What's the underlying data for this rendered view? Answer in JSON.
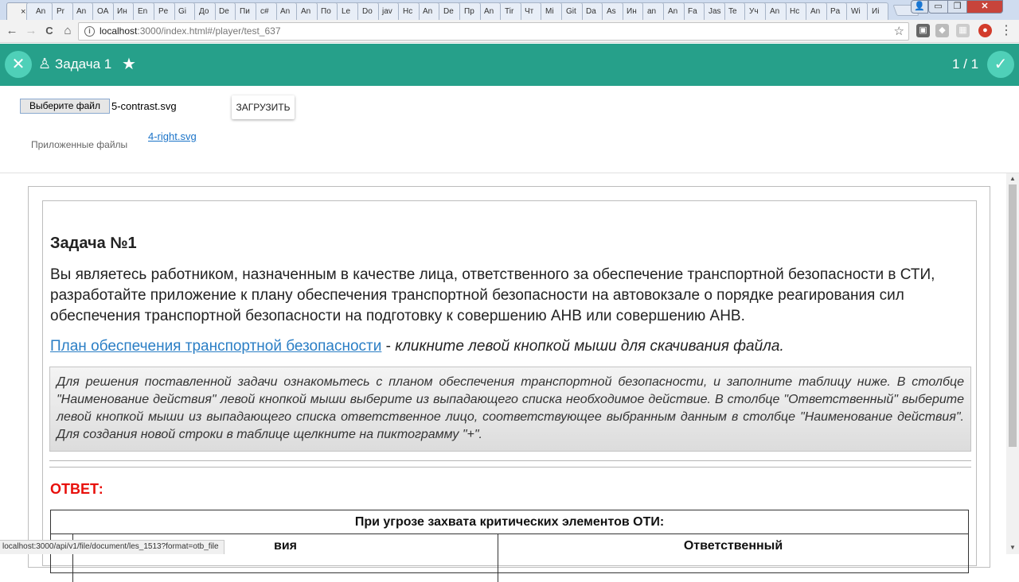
{
  "browser": {
    "tabs": [
      "An",
      "Pr",
      "An",
      "OA",
      "Ин",
      "En",
      "Pe",
      "Gi",
      "До",
      "De",
      "Пи",
      "c#",
      "An",
      "An",
      "По",
      "Le",
      "Do",
      "jav",
      "Hc",
      "An",
      "De",
      "Пр",
      "An",
      "Tir",
      "Чт",
      "Мі",
      "Git",
      "Da",
      "As",
      "Ин",
      "an",
      "An",
      "Fa",
      "Jas",
      "Te",
      "Уч",
      "An",
      "Hc",
      "An",
      "Pa",
      "Wi",
      "Иі"
    ],
    "active_tab_close": "×",
    "url_host": "localhost",
    "url_path": ":3000/index.html#/player/test_637",
    "nav": {
      "back": "←",
      "forward": "→",
      "reload": "C",
      "home": "⌂"
    },
    "bookmark_icon": "star-icon",
    "window_controls": {
      "minimize": "▭",
      "maximize": "❐",
      "close": "✕"
    }
  },
  "header": {
    "close_symbol": "✕",
    "title_icon": "♙",
    "title": "Задача 1",
    "favorite_symbol": "★",
    "counter": "1 / 1",
    "confirm_symbol": "✓",
    "accent_color": "#26a08a"
  },
  "upload": {
    "choose_label": "Выберите файл",
    "file_name": "5-contrast.svg",
    "upload_label": "ЗАГРУЗИТЬ",
    "attached_label": "Приложенные файлы",
    "attached_file": "4-right.svg"
  },
  "task": {
    "heading": "Задача №1",
    "text": "Вы являетесь работником, назначенным в качестве лица, ответственного за обеспечение транспортной безопасности в СТИ, разработайте приложение к плану обеспечения транспортной безопасности на автовокзале о порядке реагирования сил обеспечения транспортной безопасности на подготовку к совершению АНВ или совершению АНВ.",
    "plan_link": "План обеспечения транспортной безопасности",
    "plan_separator": " - ",
    "plan_hint": "кликните левой кнопкой мыши для скачивания файла.",
    "note": "Для решения поставленной задачи ознакомьтесь с планом обеспечения транспортной безопасности, и заполните таблицу ниже. В столбце \"Наименование действия\" левой кнопкой мыши выберите из выпадающего списка необходимое действие. В столбце \"Ответственный\" выберите левой кнопкой мыши из выпадающего списка ответственное лицо, соответствующее выбранным данным в столбце \"Наименование действия\". Для создания новой строки в таблице щелкните на пиктограмму \"+\".",
    "answer_label": "ОТВЕТ:",
    "answer_color": "#e8100c"
  },
  "table": {
    "caption": "При угрозе захвата критических элементов ОТИ:",
    "col1_visible": "вия",
    "col2": "Ответственный"
  },
  "status_bar": "localhost:3000/api/v1/file/document/les_1513?format=otb_file"
}
